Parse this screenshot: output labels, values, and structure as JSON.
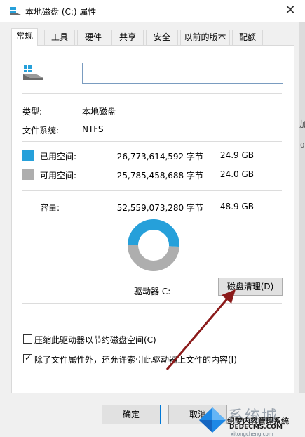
{
  "window": {
    "title": "本地磁盘 (C:) 属性",
    "close_glyph": "✕"
  },
  "tabs": [
    {
      "label": "常规",
      "active": true
    },
    {
      "label": "工具",
      "active": false
    },
    {
      "label": "硬件",
      "active": false
    },
    {
      "label": "共享",
      "active": false
    },
    {
      "label": "安全",
      "active": false
    },
    {
      "label": "以前的版本",
      "active": false
    },
    {
      "label": "配额",
      "active": false
    }
  ],
  "general": {
    "drive_name_value": "",
    "type_label": "类型:",
    "type_value": "本地磁盘",
    "fs_label": "文件系统:",
    "fs_value": "NTFS",
    "used": {
      "label": "已用空间:",
      "bytes": "26,773,614,592 字节",
      "size": "24.9 GB",
      "color": "#26a0da"
    },
    "free": {
      "label": "可用空间:",
      "bytes": "25,785,458,688 字节",
      "size": "24.0 GB",
      "color": "#aeaeae"
    },
    "capacity": {
      "label": "容量:",
      "bytes": "52,559,073,280 字节",
      "size": "48.9 GB"
    },
    "used_fraction": 0.509,
    "drive_label": "驱动器 C:",
    "cleanup_button": "磁盘清理(D)",
    "compress_option": {
      "label": "压缩此驱动器以节约磁盘空间(C)",
      "checked": false
    },
    "index_option": {
      "label": "除了文件属性外，还允许索引此驱动器上文件的内容(I)",
      "checked": true
    }
  },
  "footer": {
    "ok_button": "确定",
    "cancel_button": "取消"
  },
  "watermark": {
    "line1": "系统城",
    "line2": "织梦内容管理系统",
    "line3": "DEDECMS.COM",
    "line4": "xitongcheng.com"
  },
  "background_snippets": [
    "加",
    "0"
  ],
  "colors": {
    "used": "#26a0da",
    "free": "#aeaeae",
    "accent": "#0078d7",
    "arrow": "#8b1a1a"
  }
}
